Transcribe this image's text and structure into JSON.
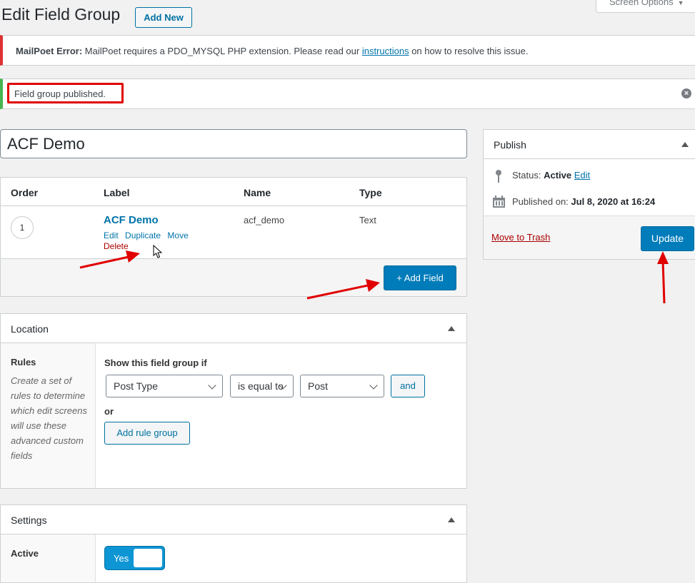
{
  "header": {
    "title": "Edit Field Group",
    "add_new_label": "Add New",
    "screen_options_label": "Screen Options"
  },
  "notices": {
    "error": {
      "prefix": "MailPoet Error:",
      "text_before": " MailPoet requires a PDO_MYSQL PHP extension. Please read our ",
      "link": "instructions",
      "text_after": " on how to resolve this issue."
    },
    "success": {
      "text": "Field group published."
    }
  },
  "title_input": {
    "value": "ACF Demo"
  },
  "fields": {
    "columns": [
      "Order",
      "Label",
      "Name",
      "Type"
    ],
    "rows": [
      {
        "order": "1",
        "label": "ACF Demo",
        "name": "acf_demo",
        "type": "Text",
        "actions": [
          "Edit",
          "Duplicate",
          "Move"
        ],
        "delete_label": "Delete"
      }
    ],
    "add_field_label": "+ Add Field"
  },
  "location": {
    "heading": "Location",
    "side_title": "Rules",
    "side_description": "Create a set of rules to determine which edit screens will use these advanced custom fields",
    "rule_title": "Show this field group if",
    "rule": {
      "param": "Post Type",
      "operator": "is equal to",
      "value": "Post"
    },
    "and_label": "and",
    "or_label": "or",
    "add_rule_group_label": "Add rule group"
  },
  "settings": {
    "heading": "Settings",
    "active_label": "Active",
    "active_value": "Yes"
  },
  "publish": {
    "heading": "Publish",
    "status_label": "Status:",
    "status_value": "Active",
    "status_edit": "Edit",
    "published_label": "Published on:",
    "published_value": "Jul 8, 2020 at 16:24",
    "trash_label": "Move to Trash",
    "update_label": "Update"
  },
  "colors": {
    "primary": "#007cba",
    "error": "#dc3232",
    "success": "#46b450",
    "annotation": "#e00000",
    "delete": "#aa0000"
  }
}
